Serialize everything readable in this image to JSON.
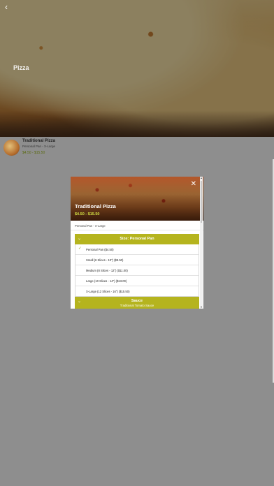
{
  "header": {
    "back_icon": "chevron-left-icon",
    "title": "Pizza"
  },
  "item": {
    "name": "Traditional Pizza",
    "sizes": "Personal Pan - X-Large",
    "price_range": "$4.50 - $15.50"
  },
  "modal": {
    "title": "Traditional Pizza",
    "price_range": "$4.50 - $15.50",
    "subtitle": "Personal Pan - X-Large",
    "close_icon": "close-icon",
    "size_group": {
      "title": "Size: Personal Pan",
      "options": [
        {
          "label": "Personal Pan ($4.50)",
          "selected": true
        },
        {
          "label": "Small (6 Slices - 10\") ($9.50)",
          "selected": false
        },
        {
          "label": "Medium (8 Slices - 12\") ($11.00)",
          "selected": false
        },
        {
          "label": "Large (10 Slices - 14\") ($13.00)",
          "selected": false
        },
        {
          "label": "X-Large (12 Slices - 16\") ($15.50)",
          "selected": false
        }
      ]
    },
    "sauce_group": {
      "title": "Sauce",
      "selected": "Traditional Tomato Sauce"
    }
  },
  "colors": {
    "accent": "#b5b41e",
    "price": "#d3e044",
    "overlay": "#8e8e8e"
  }
}
